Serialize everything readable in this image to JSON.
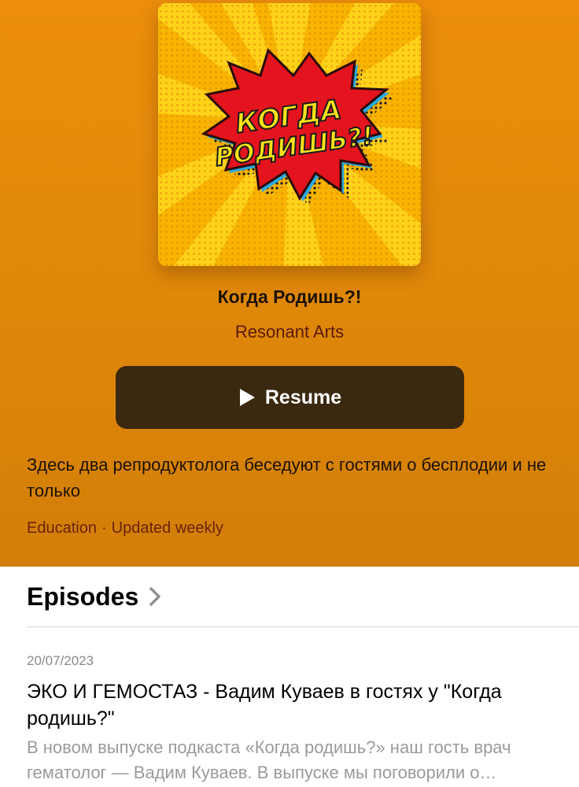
{
  "podcast": {
    "title": "Когда Родишь?!",
    "author": "Resonant Arts",
    "artwork_text_line1": "КОГДА",
    "artwork_text_line2": "РОДИШЬ?!",
    "description": "Здесь два репродуктолога беседуют с гостями о бесплодии и не только",
    "category": "Education",
    "separator": "·",
    "frequency": "Updated weekly"
  },
  "actions": {
    "resume_label": "Resume",
    "resume_icon": "play-icon"
  },
  "episodes": {
    "section_title": "Episodes",
    "chevron_icon": "chevron-right-icon",
    "items": [
      {
        "date": "20/07/2023",
        "title": "ЭКО И ГЕМОСТАЗ - Вадим Куваев в гостях у \"Когда родишь?\"",
        "description": "В новом выпуске подкаста «Когда родишь?» наш гость врач гематолог — Вадим Куваев.  В выпуске мы поговорили о гемостазе и ЭКО"
      }
    ]
  },
  "colors": {
    "header_bg": "#e38a0a",
    "resume_bg": "#3a2810",
    "author_text": "#5a1a06",
    "muted_text": "#9a9a9e"
  }
}
